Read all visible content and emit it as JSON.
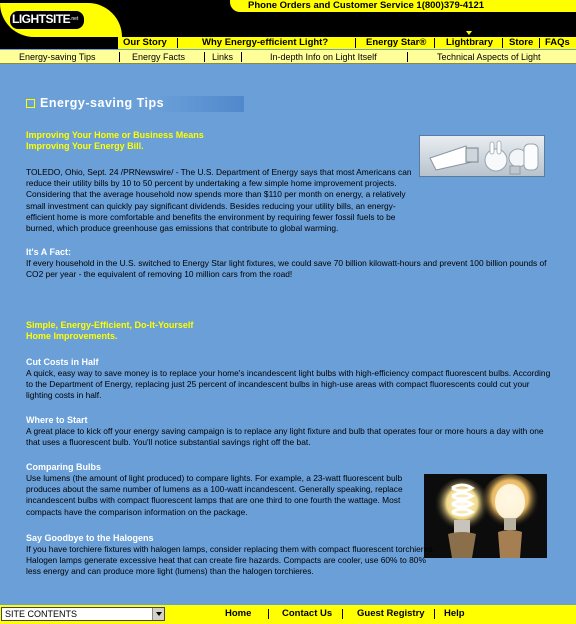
{
  "header": {
    "logo_text": "LIGHTSITE",
    "logo_suffix": ".net",
    "phone_text": "Phone Orders and Customer Service 1(800)379-4121"
  },
  "main_nav": {
    "items": [
      "Our Story",
      "Why Energy-efficient Light?",
      "Energy Star®",
      "Lightbrary",
      "Store",
      "FAQs"
    ]
  },
  "sub_nav": {
    "items": [
      "Energy-saving Tips",
      "Energy Facts",
      "Links",
      "In-depth Info on Light Itself",
      "Technical Aspects of Light"
    ]
  },
  "content": {
    "heading": "Energy-saving Tips",
    "article1": {
      "title_line1": "Improving Your Home or Business Means",
      "title_line2": "Improving Your Energy Bill.",
      "body": "TOLEDO, Ohio, Sept. 24 /PRNewswire/ - The U.S. Department of Energy says that most Americans can reduce their utility bills by 10 to 50 percent by undertaking a few simple home improvement projects. Considering that the average household now spends more than $110 per month on energy, a relatively small investment can quickly pay significant dividends. Besides reducing your utility bills, an energy-efficient home is more comfortable and benefits the environment by requiring fewer fossil fuels to be burned, which produce greenhouse gas emissions that contribute to global warming."
    },
    "fact": {
      "title": "It's A Fact:",
      "body": "If every household in the U.S. switched to Energy Star light fixtures, we could save 70 billion kilowatt-hours and prevent 100 billion pounds of CO2 per year - the equivalent of removing 10 million cars from the road!"
    },
    "article2": {
      "title_line1": "Simple, Energy-Efficient, Do-It-Yourself",
      "title_line2": "Home Improvements."
    },
    "tips": [
      {
        "title": "Cut Costs in Half",
        "body": "A quick, easy way to save money is to replace your home's incandescent light bulbs with high-efficiency compact fluorescent bulbs. According to the Department of Energy, replacing just 25 percent of incandescent bulbs in high-use areas with compact fluorescents could cut your lighting costs in half."
      },
      {
        "title": "Where to Start",
        "body": "A great place to kick off your energy saving campaign is to replace any light fixture and bulb that operates four or more hours a day with one that uses a fluorescent bulb. You'll notice substantial savings right off the bat."
      },
      {
        "title": "Comparing Bulbs",
        "body": "Use lumens (the amount of light produced) to compare lights. For example, a 23-watt fluorescent bulb produces about the same number of lumens as a 100-watt incandescent. Generally speaking, replace incandescent bulbs with compact fluorescent lamps that are one third to one fourth the wattage. Most compacts have the comparison information on the package."
      },
      {
        "title": "Say Goodbye to the Halogens",
        "body": "If you have torchiere fixtures with halogen lamps, consider replacing them with compact fluorescent torchieres. Halogen lamps generate excessive heat that can create fire hazards. Compacts are cooler, use 60% to 80% less energy and can produce more light (lumens) than the halogen torchieres."
      }
    ]
  },
  "footer": {
    "select_value": "SITE CONTENTS",
    "links": [
      "Home",
      "Contact Us",
      "Guest Registry",
      "Help"
    ]
  },
  "colors": {
    "background": "#6a9fd8",
    "accent": "#ffff00",
    "subnav": "#ffff99"
  }
}
